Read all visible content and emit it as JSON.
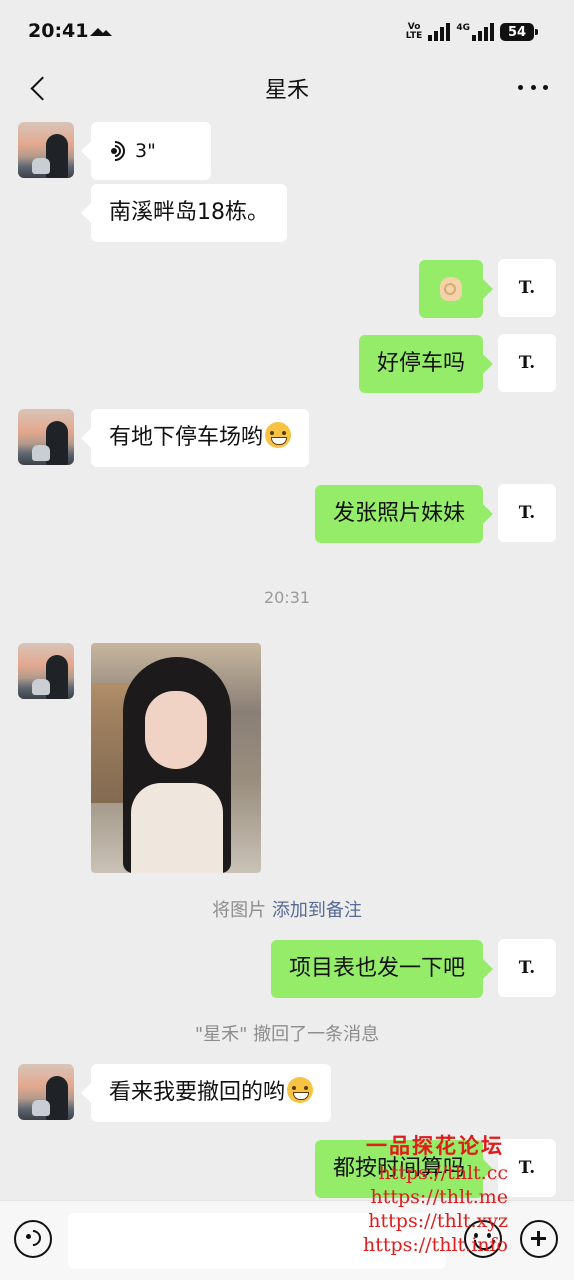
{
  "status_bar": {
    "time": "20:41",
    "volte_top": "Vo",
    "volte_bottom": "LTE",
    "network": "4G",
    "battery": "54"
  },
  "header": {
    "title": "星禾",
    "back_icon": "chevron-left-icon",
    "more_icon": "more-dots-icon"
  },
  "messages": [
    {
      "side": "in",
      "type": "voice",
      "duration": "3\""
    },
    {
      "side": "in",
      "type": "text",
      "text": "南溪畔岛18栋。"
    },
    {
      "side": "out",
      "type": "emoji",
      "emoji": "ok-hand"
    },
    {
      "side": "out",
      "type": "text",
      "text": "好停车吗"
    },
    {
      "side": "in",
      "type": "text",
      "text": "有地下停车场哟",
      "emoji": "grin"
    },
    {
      "side": "out",
      "type": "text",
      "text": "发张照片妹妹"
    },
    {
      "type": "timestamp",
      "text": "20:31"
    },
    {
      "side": "in",
      "type": "image"
    },
    {
      "type": "system",
      "text": "将图片",
      "link": "添加到备注"
    },
    {
      "side": "out",
      "type": "text",
      "text": "项目表也发一下吧"
    },
    {
      "type": "system",
      "text": "\"星禾\" 撤回了一条消息"
    },
    {
      "side": "in",
      "type": "text",
      "text": "看来我要撤回的哟",
      "emoji": "wink"
    },
    {
      "side": "out",
      "type": "text",
      "text": "都按时间算吗"
    }
  ],
  "self_avatar_text": "T.",
  "watermark": {
    "title": "一品探花论坛",
    "lines": [
      "https://thlt.cc",
      "https://thlt.me",
      "https://thlt.xyz",
      "https://thlt.info"
    ]
  },
  "colors": {
    "background": "#ededed",
    "outgoing_bubble": "#95ec69",
    "incoming_bubble": "#ffffff",
    "link": "#576b95",
    "watermark": "#e01c1c"
  }
}
